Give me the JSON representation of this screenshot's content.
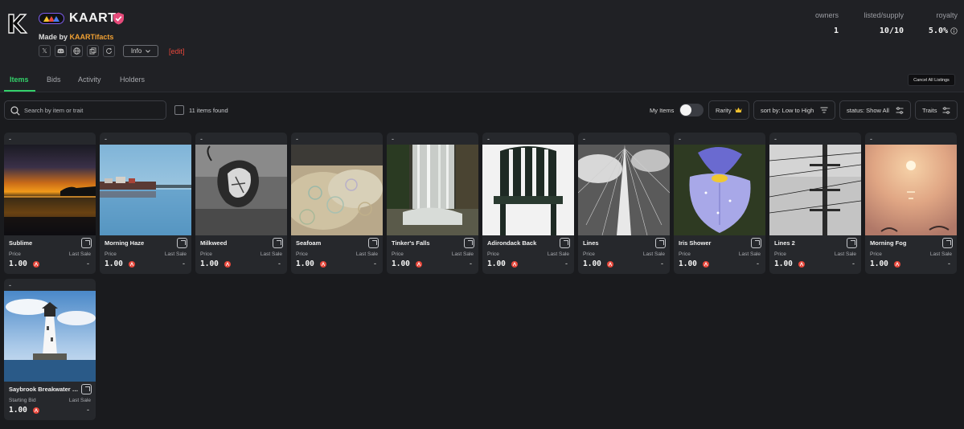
{
  "collection": {
    "title": "KAART",
    "made_by_prefix": "Made by",
    "creator": "KAARTifacts",
    "info_label": "Info",
    "edit_label": "[edit]",
    "socials": [
      "x-icon",
      "discord-icon",
      "website-icon",
      "copy-icon",
      "refresh-icon"
    ]
  },
  "stats": {
    "owners_label": "owners",
    "owners_value": "1",
    "listed_label": "listed/supply",
    "listed_value": "10/10",
    "royalty_label": "royalty",
    "royalty_value": "5.0%"
  },
  "tabs": [
    "Items",
    "Bids",
    "Activity",
    "Holders"
  ],
  "active_tab": "Items",
  "cancel_all_label": "Cancel All Listings",
  "filters": {
    "search_placeholder": "Search by item or trait",
    "found_text": "11 items found",
    "my_items_label": "My Items",
    "rarity_label": "Rarity",
    "sort_label": "sort by: Low to High",
    "status_label": "status: Show All",
    "traits_label": "Traits"
  },
  "colors": {
    "accent": "#33d16a",
    "creator": "#f0a033",
    "edit": "#e8473b",
    "token": "#e8473b"
  },
  "items": [
    {
      "top": "-",
      "name": "Sublime",
      "price_label": "Price",
      "last_label": "Last Sale",
      "price": "1.00",
      "last_sale": "-"
    },
    {
      "top": "-",
      "name": "Morning Haze",
      "price_label": "Price",
      "last_label": "Last Sale",
      "price": "1.00",
      "last_sale": "-"
    },
    {
      "top": "-",
      "name": "Milkweed",
      "price_label": "Price",
      "last_label": "Last Sale",
      "price": "1.00",
      "last_sale": "-"
    },
    {
      "top": "-",
      "name": "Seafoam",
      "price_label": "Price",
      "last_label": "Last Sale",
      "price": "1.00",
      "last_sale": "-"
    },
    {
      "top": "-",
      "name": "Tinker's Falls",
      "price_label": "Price",
      "last_label": "Last Sale",
      "price": "1.00",
      "last_sale": "-"
    },
    {
      "top": "-",
      "name": "Adirondack Back",
      "price_label": "Price",
      "last_label": "Last Sale",
      "price": "1.00",
      "last_sale": "-"
    },
    {
      "top": "-",
      "name": "Lines",
      "price_label": "Price",
      "last_label": "Last Sale",
      "price": "1.00",
      "last_sale": "-"
    },
    {
      "top": "-",
      "name": "Iris Shower",
      "price_label": "Price",
      "last_label": "Last Sale",
      "price": "1.00",
      "last_sale": "-"
    },
    {
      "top": "-",
      "name": "Lines 2",
      "price_label": "Price",
      "last_label": "Last Sale",
      "price": "1.00",
      "last_sale": "-"
    },
    {
      "top": "-",
      "name": "Morning Fog",
      "price_label": "Price",
      "last_label": "Last Sale",
      "price": "1.00",
      "last_sale": "-"
    },
    {
      "top": "-",
      "name": "Saybrook Breakwater L...",
      "price_label": "Starting Bid",
      "last_label": "Last Sale",
      "price": "1.00",
      "last_sale": "-"
    }
  ]
}
